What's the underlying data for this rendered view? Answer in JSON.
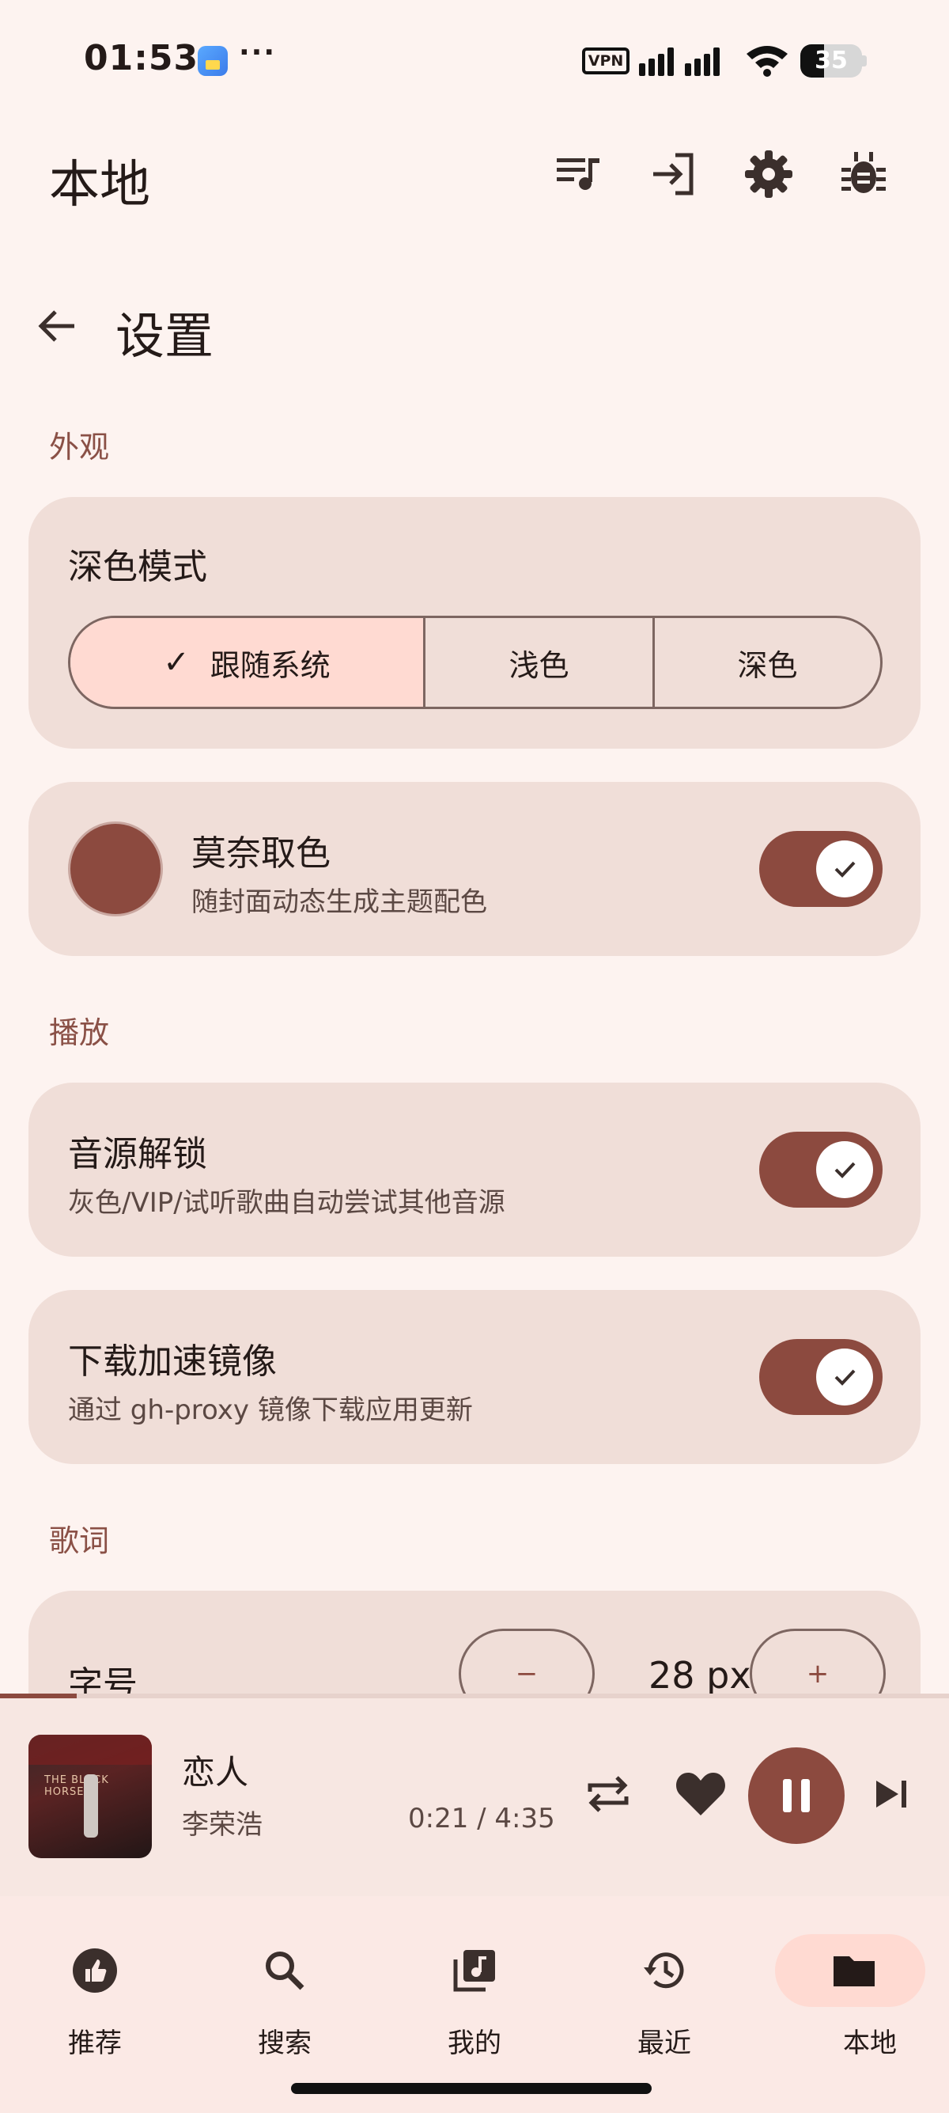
{
  "status_bar": {
    "time": "01:53",
    "more": "···",
    "vpn": "VPN",
    "battery": "35"
  },
  "top_bar": {
    "title": "本地",
    "icons": [
      "queue-music-icon",
      "login-icon",
      "gear-icon",
      "bug-icon"
    ]
  },
  "settings": {
    "title": "设置",
    "appearance": {
      "section": "外观",
      "dark_mode": {
        "title": "深色模式",
        "options": [
          "跟随系统",
          "浅色",
          "深色"
        ],
        "selected": "跟随系统"
      },
      "monet": {
        "title": "莫奈取色",
        "subtitle": "随封面动态生成主题配色",
        "enabled": true,
        "swatch_color": "#8c4a3f"
      }
    },
    "playback": {
      "section": "播放",
      "unlock": {
        "title": "音源解锁",
        "subtitle": "灰色/VIP/试听歌曲自动尝试其他音源",
        "enabled": true
      },
      "mirror": {
        "title": "下载加速镜像",
        "subtitle": "通过 gh-proxy 镜像下载应用更新",
        "enabled": true
      }
    },
    "lyrics": {
      "section": "歌词",
      "font_size": {
        "title": "字号",
        "value": "28 px",
        "minus": "−",
        "plus": "+"
      }
    }
  },
  "player": {
    "title": "恋人",
    "artist": "李荣浩",
    "time": "0:21 / 4:35",
    "progress_fraction": 0.0805,
    "cover_text": "THE BLACK HORSE"
  },
  "bottom_nav": {
    "items": [
      {
        "label": "推荐",
        "icon": "thumb-up-icon"
      },
      {
        "label": "搜索",
        "icon": "search-icon"
      },
      {
        "label": "我的",
        "icon": "library-music-icon"
      },
      {
        "label": "最近",
        "icon": "history-icon"
      },
      {
        "label": "本地",
        "icon": "folder-icon",
        "active": true
      }
    ]
  },
  "colors": {
    "accent": "#8c4a3f",
    "selected_container": "#ffdad2",
    "card": "#f0ded8",
    "background": "#fdf3f0"
  }
}
